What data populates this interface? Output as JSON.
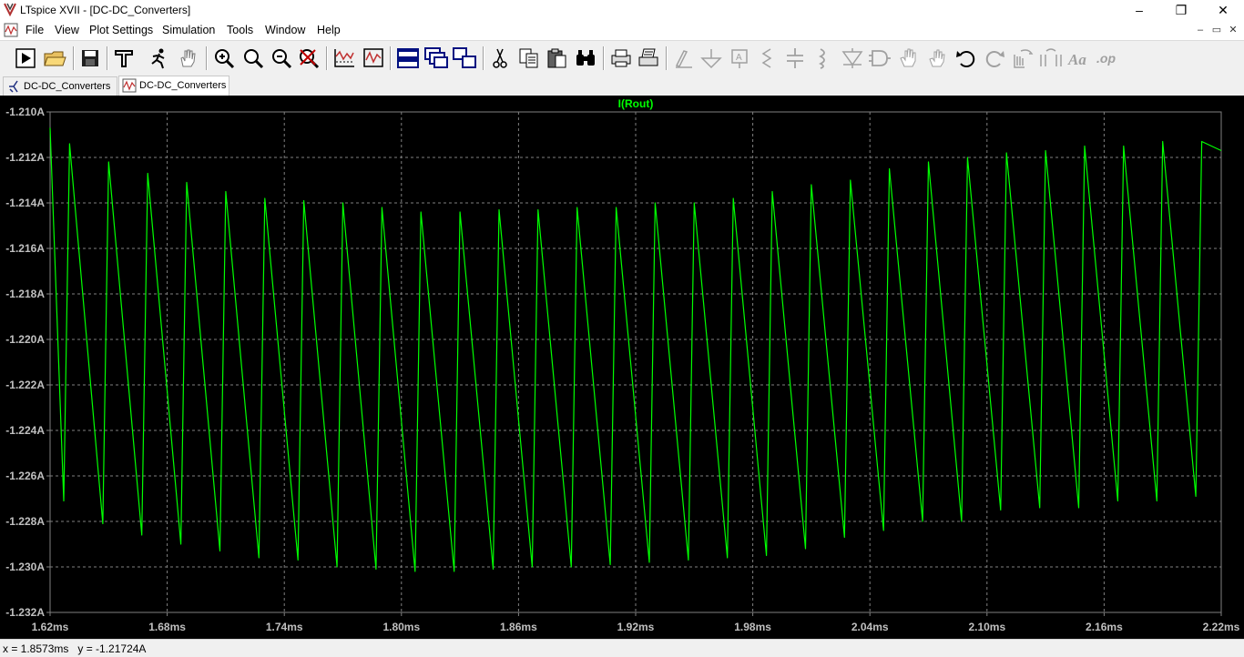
{
  "window": {
    "title": "LTspice XVII - [DC-DC_Converters]",
    "controls": {
      "minimize": "–",
      "maximize": "❐",
      "close": "✕"
    }
  },
  "menu": {
    "items": [
      {
        "label": "File"
      },
      {
        "label": "View"
      },
      {
        "label": "Plot Settings"
      },
      {
        "label": "Simulation"
      },
      {
        "label": "Tools"
      },
      {
        "label": "Window"
      },
      {
        "label": "Help"
      }
    ],
    "mdi_controls": {
      "minimize": "–",
      "restore": "▭",
      "close": "✕"
    }
  },
  "toolbar": {
    "buttons": [
      "run-icon",
      "open-icon",
      "save-icon",
      "control-panel-icon",
      "halt-icon",
      "pan-hand-icon",
      "zoom-in-icon",
      "zoom-area-icon",
      "zoom-out-icon",
      "zoom-cancel-icon",
      "autorange-icon",
      "manual-limits-icon",
      "tile-horizontal-icon",
      "cascade-icon",
      "tile-vertical-icon",
      "cut-icon",
      "copy-icon",
      "paste-icon",
      "find-icon",
      "print-icon",
      "print-setup-icon",
      "wire-icon",
      "ground-icon",
      "label-net-icon",
      "resistor-icon",
      "capacitor-icon",
      "inductor-icon",
      "diode-icon",
      "component-icon",
      "move-icon",
      "drag-icon",
      "undo-icon",
      "redo-icon",
      "rotate-icon",
      "mirror-icon",
      "text-icon",
      "spice-directive-icon"
    ]
  },
  "tabs": [
    {
      "label": "DC-DC_Converters",
      "kind": "schematic"
    },
    {
      "label": "DC-DC_Converters",
      "kind": "waveform",
      "active": true
    }
  ],
  "colors": {
    "plot_bg": "#000000",
    "trace": "#00ff00",
    "grid": "#808080",
    "axis_text": "#c0c0c0",
    "trace_label": "#00ff00"
  },
  "chart_data": {
    "type": "line",
    "title": "I(Rout)",
    "xlabel": "",
    "ylabel": "",
    "x_unit": "ms",
    "xlim": [
      1.62,
      2.22
    ],
    "ylim": [
      -1.232,
      -1.21
    ],
    "xticks": [
      1.62,
      1.68,
      1.74,
      1.8,
      1.86,
      1.92,
      1.98,
      2.04,
      2.1,
      2.16,
      2.22
    ],
    "xtick_labels": [
      "1.62ms",
      "1.68ms",
      "1.74ms",
      "1.80ms",
      "1.86ms",
      "1.92ms",
      "1.98ms",
      "2.04ms",
      "2.10ms",
      "2.16ms",
      "2.22ms"
    ],
    "yticks": [
      -1.21,
      -1.212,
      -1.214,
      -1.216,
      -1.218,
      -1.22,
      -1.222,
      -1.224,
      -1.226,
      -1.228,
      -1.23,
      -1.232
    ],
    "ytick_labels": [
      "-1.210A",
      "-1.212A",
      "-1.214A",
      "-1.216A",
      "-1.218A",
      "-1.220A",
      "-1.222A",
      "-1.224A",
      "-1.226A",
      "-1.228A",
      "-1.230A",
      "-1.232A"
    ],
    "grid": true,
    "series": [
      {
        "name": "I(Rout)",
        "color": "#00ff00",
        "x": [
          1.62,
          1.627,
          1.63,
          1.647,
          1.65,
          1.667,
          1.67,
          1.687,
          1.69,
          1.707,
          1.71,
          1.727,
          1.73,
          1.747,
          1.75,
          1.767,
          1.77,
          1.787,
          1.79,
          1.807,
          1.81,
          1.827,
          1.83,
          1.847,
          1.85,
          1.867,
          1.87,
          1.887,
          1.89,
          1.907,
          1.91,
          1.927,
          1.93,
          1.947,
          1.95,
          1.967,
          1.97,
          1.987,
          1.99,
          2.007,
          2.01,
          2.027,
          2.03,
          2.047,
          2.05,
          2.067,
          2.07,
          2.087,
          2.09,
          2.107,
          2.11,
          2.127,
          2.13,
          2.147,
          2.15,
          2.167,
          2.17,
          2.187,
          2.19,
          2.207,
          2.21,
          2.22
        ],
        "y": [
          -1.2107,
          -1.2271,
          -1.2114,
          -1.2281,
          -1.2122,
          -1.2286,
          -1.2127,
          -1.229,
          -1.2131,
          -1.2293,
          -1.2135,
          -1.2296,
          -1.2138,
          -1.2297,
          -1.2139,
          -1.23,
          -1.214,
          -1.2301,
          -1.2142,
          -1.2302,
          -1.2144,
          -1.2302,
          -1.2144,
          -1.2301,
          -1.2143,
          -1.23,
          -1.2143,
          -1.23,
          -1.2142,
          -1.2299,
          -1.2142,
          -1.2298,
          -1.214,
          -1.2297,
          -1.214,
          -1.2296,
          -1.2138,
          -1.2295,
          -1.2135,
          -1.2292,
          -1.2132,
          -1.2287,
          -1.213,
          -1.2284,
          -1.2125,
          -1.228,
          -1.2122,
          -1.228,
          -1.212,
          -1.2275,
          -1.2118,
          -1.2274,
          -1.2117,
          -1.2274,
          -1.2115,
          -1.2271,
          -1.2115,
          -1.2271,
          -1.2113,
          -1.2269,
          -1.2113,
          -1.2117
        ]
      }
    ]
  },
  "status": {
    "text": "x = 1.8573ms   y = -1.21724A"
  }
}
